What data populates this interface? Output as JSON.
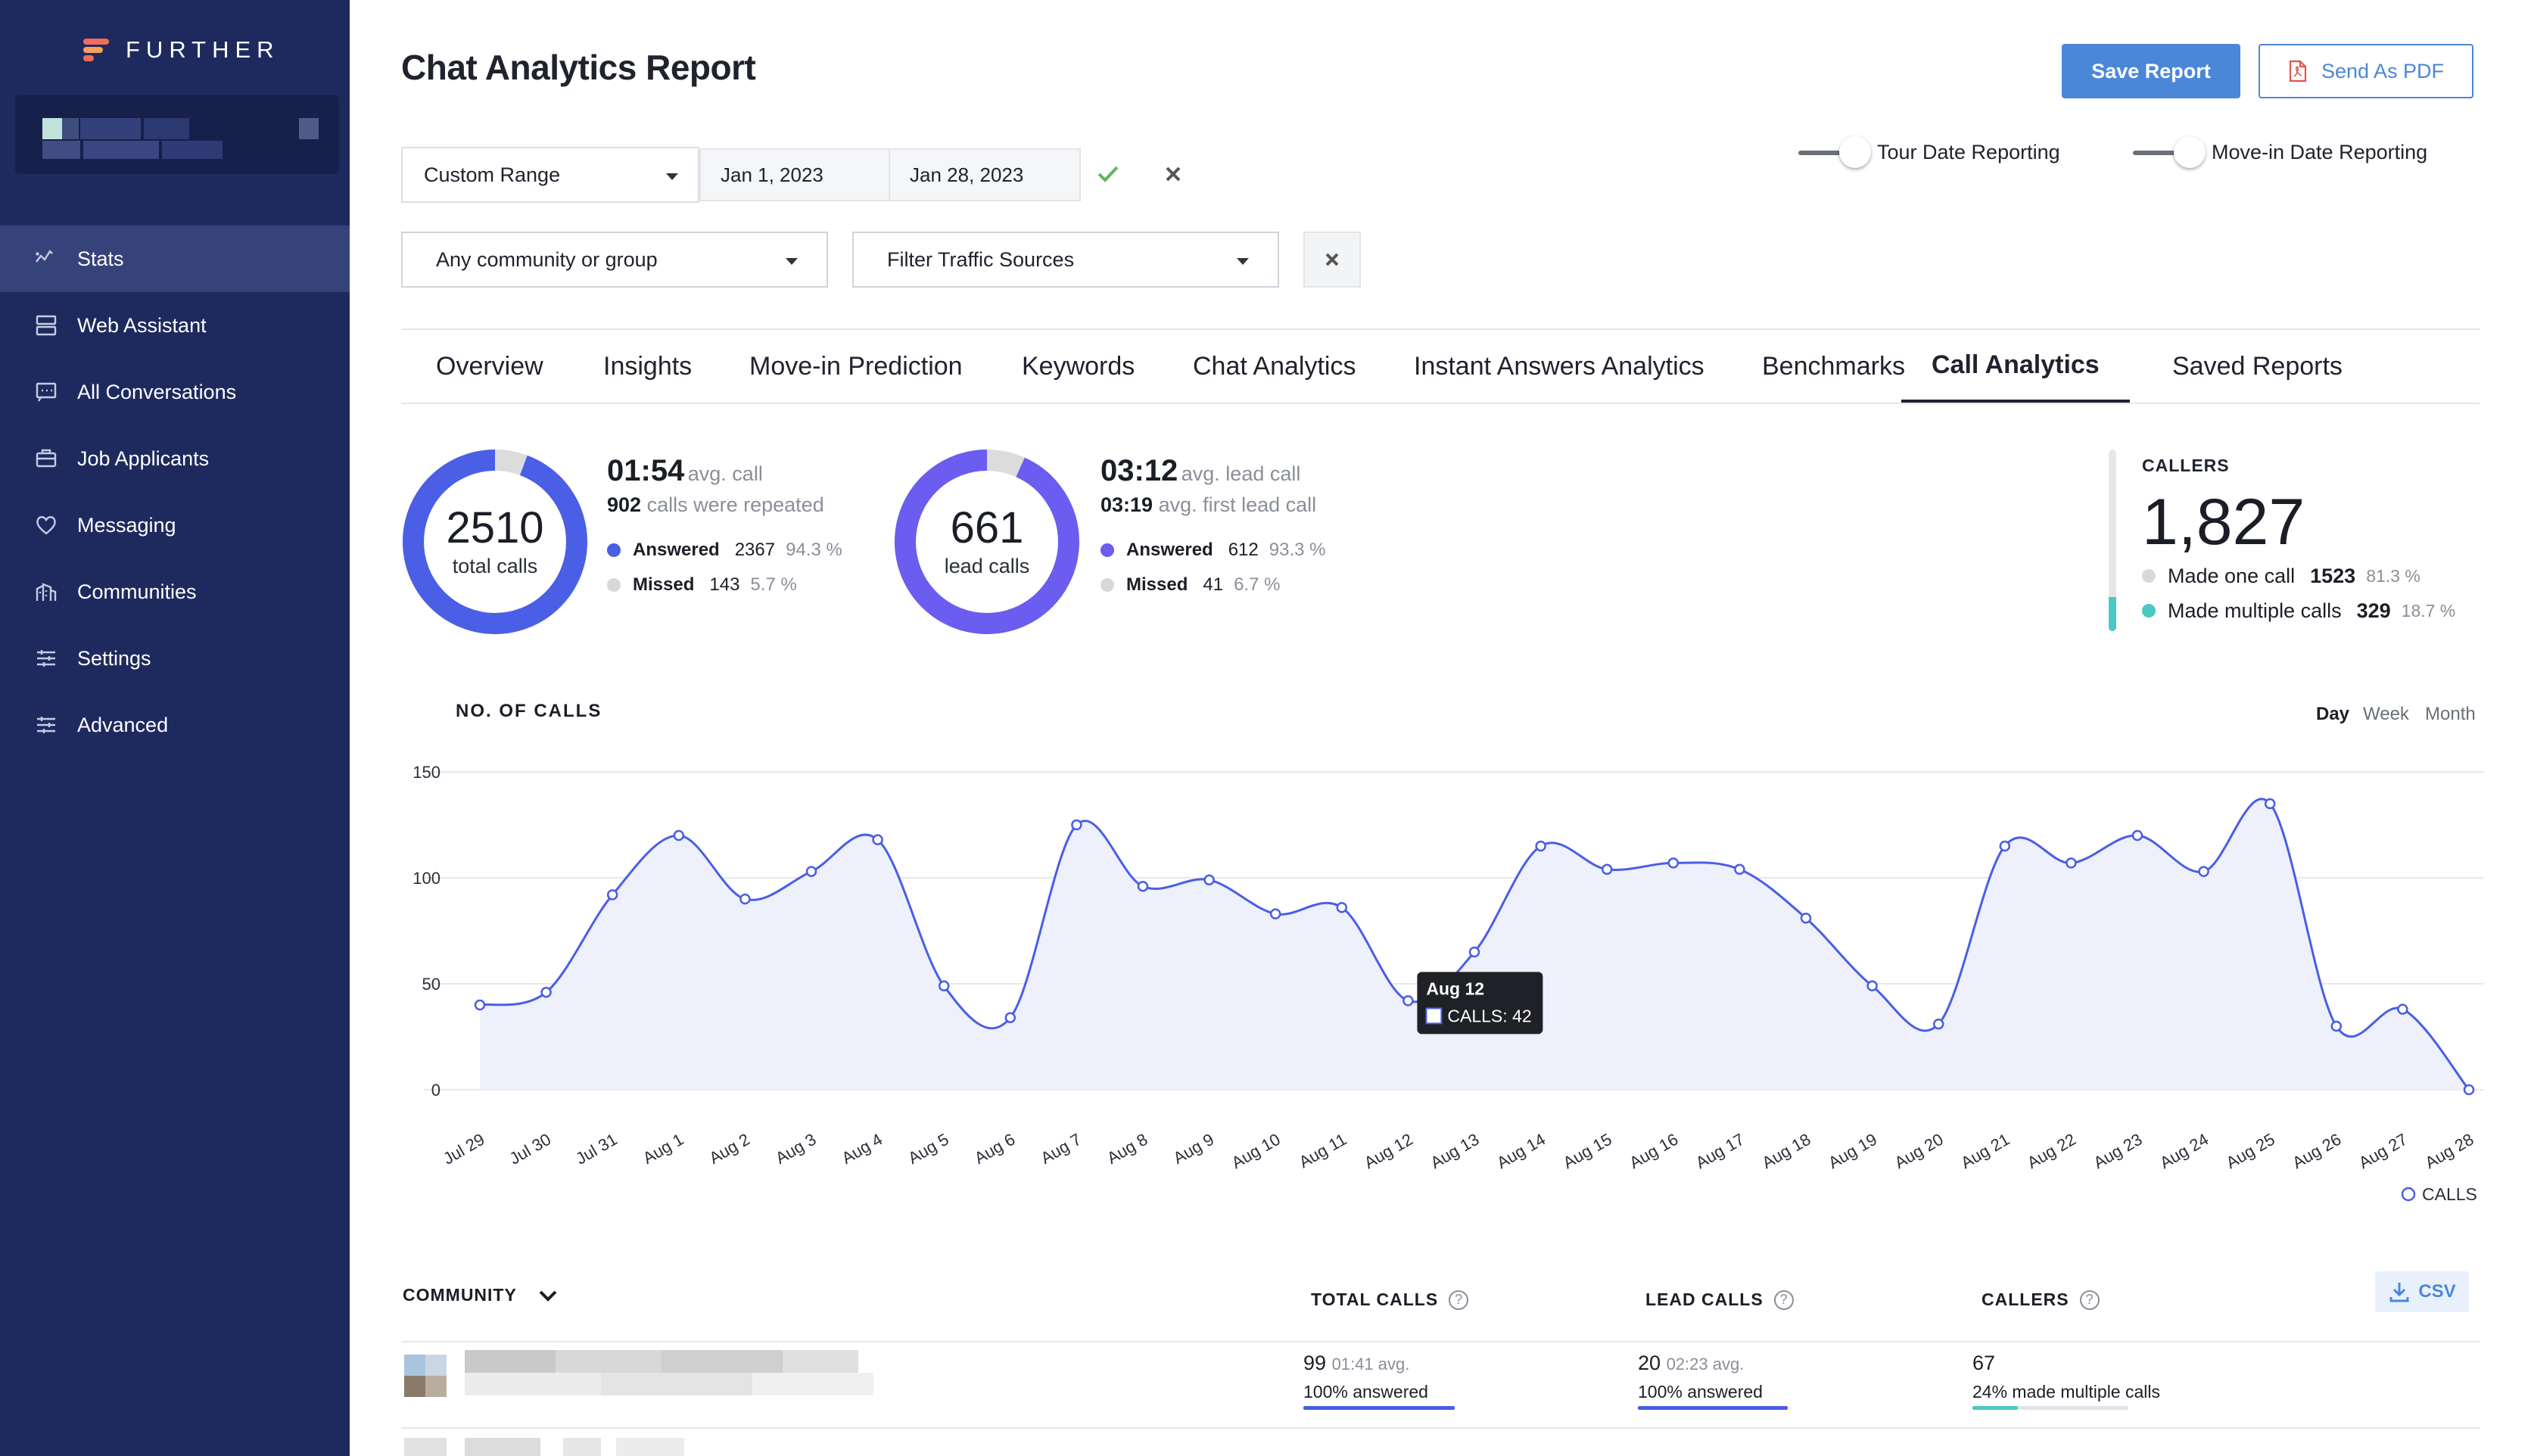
{
  "app": {
    "brand": "FURTHER",
    "colors": {
      "sidebar": "#1e2a5e",
      "accent": "#4b87d7",
      "ring": "#4a5ee6",
      "ring2": "#6a5df0",
      "teal": "#4bc8c2"
    }
  },
  "sidebar": {
    "items": [
      {
        "label": "Stats",
        "icon": "stats-icon",
        "active": true
      },
      {
        "label": "Web Assistant",
        "icon": "server-icon",
        "active": false
      },
      {
        "label": "All Conversations",
        "icon": "chat-icon",
        "active": false
      },
      {
        "label": "Job Applicants",
        "icon": "briefcase-icon",
        "active": false
      },
      {
        "label": "Messaging",
        "icon": "heart-icon",
        "active": false
      },
      {
        "label": "Communities",
        "icon": "building-icon",
        "active": false
      },
      {
        "label": "Settings",
        "icon": "sliders-icon",
        "active": false
      },
      {
        "label": "Advanced",
        "icon": "sliders-icon",
        "active": false
      }
    ]
  },
  "header": {
    "title": "Chat Analytics Report",
    "save_label": "Save Report",
    "pdf_label": "Send As PDF"
  },
  "filters": {
    "range_select": "Custom Range",
    "start_date": "Jan 1, 2023",
    "end_date": "Jan 28, 2023",
    "community_select": "Any community or group",
    "traffic_select": "Filter Traffic Sources",
    "toggle_tour": "Tour Date Reporting",
    "toggle_movein": "Move-in Date Reporting"
  },
  "tabs": [
    "Overview",
    "Insights",
    "Move-in Prediction",
    "Keywords",
    "Chat Analytics",
    "Instant Answers Analytics",
    "Benchmarks",
    "Call Analytics",
    "Saved Reports"
  ],
  "active_tab": "Call Analytics",
  "stats": {
    "total": {
      "count": "2510",
      "label": "total calls",
      "answered_fraction": 0.943,
      "avg_time": "01:54",
      "avg_label": "avg. call",
      "repeated_count": "902",
      "repeated_label": "calls were repeated",
      "answered_label": "Answered",
      "answered_count": "2367",
      "answered_pct": "94.3 %",
      "missed_label": "Missed",
      "missed_count": "143",
      "missed_pct": "5.7 %"
    },
    "lead": {
      "count": "661",
      "label": "lead calls",
      "answered_fraction": 0.933,
      "avg_time": "03:12",
      "avg_label": "avg. lead call",
      "first_time": "03:19",
      "first_label": "avg. first lead call",
      "answered_label": "Answered",
      "answered_count": "612",
      "answered_pct": "93.3 %",
      "missed_label": "Missed",
      "missed_count": "41",
      "missed_pct": "6.7 %"
    },
    "callers": {
      "heading": "CALLERS",
      "count": "1,827",
      "multiple_fraction": 0.187,
      "one_label": "Made one call",
      "one_count": "1523",
      "one_pct": "81.3 %",
      "multi_label": "Made multiple calls",
      "multi_count": "329",
      "multi_pct": "18.7 %"
    }
  },
  "chart_section": {
    "title": "NO. OF CALLS",
    "granularity": [
      "Day",
      "Week",
      "Month"
    ],
    "active_granularity": "Day",
    "legend": "CALLS",
    "tooltip": {
      "title": "Aug 12",
      "text": "CALLS: 42"
    }
  },
  "chart_data": {
    "type": "area",
    "title": "NO. OF CALLS",
    "categories": [
      "Jul 29",
      "Jul 30",
      "Jul 31",
      "Aug 1",
      "Aug 2",
      "Aug 3",
      "Aug 4",
      "Aug 5",
      "Aug 6",
      "Aug 7",
      "Aug 8",
      "Aug 9",
      "Aug 10",
      "Aug 11",
      "Aug 12",
      "Aug 13",
      "Aug 14",
      "Aug 15",
      "Aug 16",
      "Aug 17",
      "Aug 18",
      "Aug 19",
      "Aug 20",
      "Aug 21",
      "Aug 22",
      "Aug 23",
      "Aug 24",
      "Aug 25",
      "Aug 26",
      "Aug 27",
      "Aug 28"
    ],
    "series": [
      {
        "name": "CALLS",
        "values": [
          40,
          46,
          92,
          120,
          90,
          103,
          118,
          49,
          34,
          125,
          96,
          99,
          83,
          86,
          42,
          65,
          115,
          104,
          107,
          104,
          81,
          49,
          31,
          115,
          107,
          120,
          103,
          135,
          30,
          38,
          0
        ]
      }
    ],
    "yticks": [
      0,
      50,
      100,
      150
    ],
    "ylim": [
      0,
      150
    ],
    "grid": true,
    "legend_position": "bottom-right"
  },
  "table": {
    "headers": {
      "community": "COMMUNITY",
      "total": "TOTAL CALLS",
      "lead": "LEAD CALLS",
      "callers": "CALLERS"
    },
    "csv_label": "CSV",
    "rows": [
      {
        "total_main": "99",
        "total_avg": "01:41 avg.",
        "total_sub": "100% answered",
        "lead_main": "20",
        "lead_avg": "02:23 avg.",
        "lead_sub": "100% answered",
        "callers_main": "67",
        "callers_sub": "24% made multiple calls"
      }
    ]
  }
}
